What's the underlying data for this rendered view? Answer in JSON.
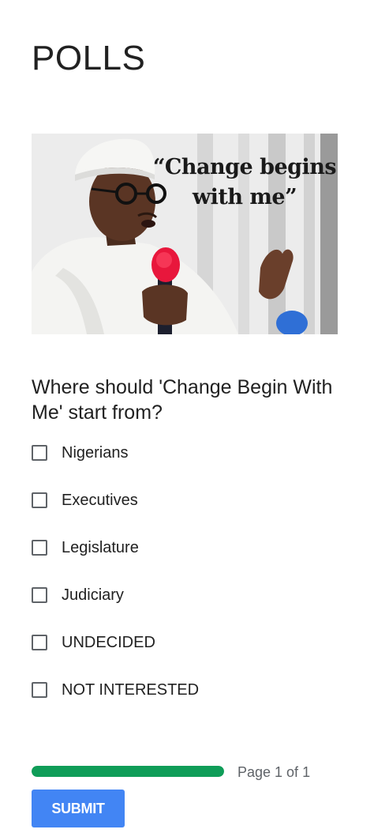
{
  "form": {
    "title": "POLLS",
    "image": {
      "caption": "“Change begins with me”"
    },
    "question": "Where should 'Change Begin With Me' start from?",
    "options": [
      {
        "label": "Nigerians",
        "checked": false
      },
      {
        "label": "Executives",
        "checked": false
      },
      {
        "label": "Legislature",
        "checked": false
      },
      {
        "label": "Judiciary",
        "checked": false
      },
      {
        "label": "UNDECIDED",
        "checked": false
      },
      {
        "label": "NOT INTERESTED",
        "checked": false
      }
    ],
    "progress": {
      "fraction": 1.0,
      "label": "Page 1 of 1",
      "color": "#0f9d58"
    },
    "submit_label": "SUBMIT"
  },
  "colors": {
    "accent": "#4285f4",
    "progress": "#0f9d58",
    "text": "#212121"
  }
}
